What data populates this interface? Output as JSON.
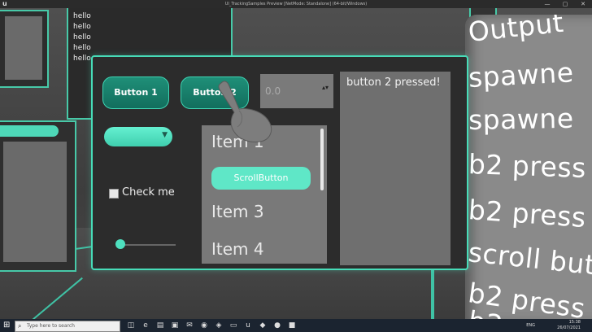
{
  "window": {
    "title": "UI_TrackingSamples Preview [NetMode: Standalone]  (64-bit/Windows)",
    "app_icon": "unreal-logo-icon",
    "controls": [
      "—",
      "▢",
      "✕"
    ]
  },
  "background": {
    "hello_lines": [
      "hello",
      "hello",
      "hello",
      "hello",
      "hello"
    ]
  },
  "output_panel": {
    "lines": [
      "Output",
      "spawne",
      "spawne",
      "b2 press",
      "b2 press",
      "scroll but",
      "b2 press",
      "b2"
    ]
  },
  "main_panel": {
    "button1_label": "Button 1",
    "button2_label": "Button 2",
    "spin_value": "0.0",
    "spin_arrows": "▴▾",
    "combo_arrow": "▼",
    "checkbox_label": "Check me",
    "checkbox_checked": false,
    "slider_value": 0,
    "list_items": [
      "Item 1",
      "Item 3",
      "Item 4"
    ],
    "scroll_button_label": "ScrollButton",
    "output_text": "button 2 pressed!"
  },
  "taskbar": {
    "start_icon": "windows-start-icon",
    "search_placeholder": "Type here to search",
    "apps": [
      "task-view-icon",
      "edge-icon",
      "file-explorer-icon",
      "store-icon",
      "mail-icon",
      "chrome-icon",
      "vs-icon",
      "terminal-icon",
      "ue-icon",
      "app-icon",
      "app-icon",
      "app-icon"
    ],
    "language": "ENG",
    "time": "15:38",
    "date": "26/07/2021"
  },
  "colors": {
    "accent": "#47dcb8",
    "button_fill": "#1f8f78",
    "panel_bg": "#2c2c2c"
  }
}
